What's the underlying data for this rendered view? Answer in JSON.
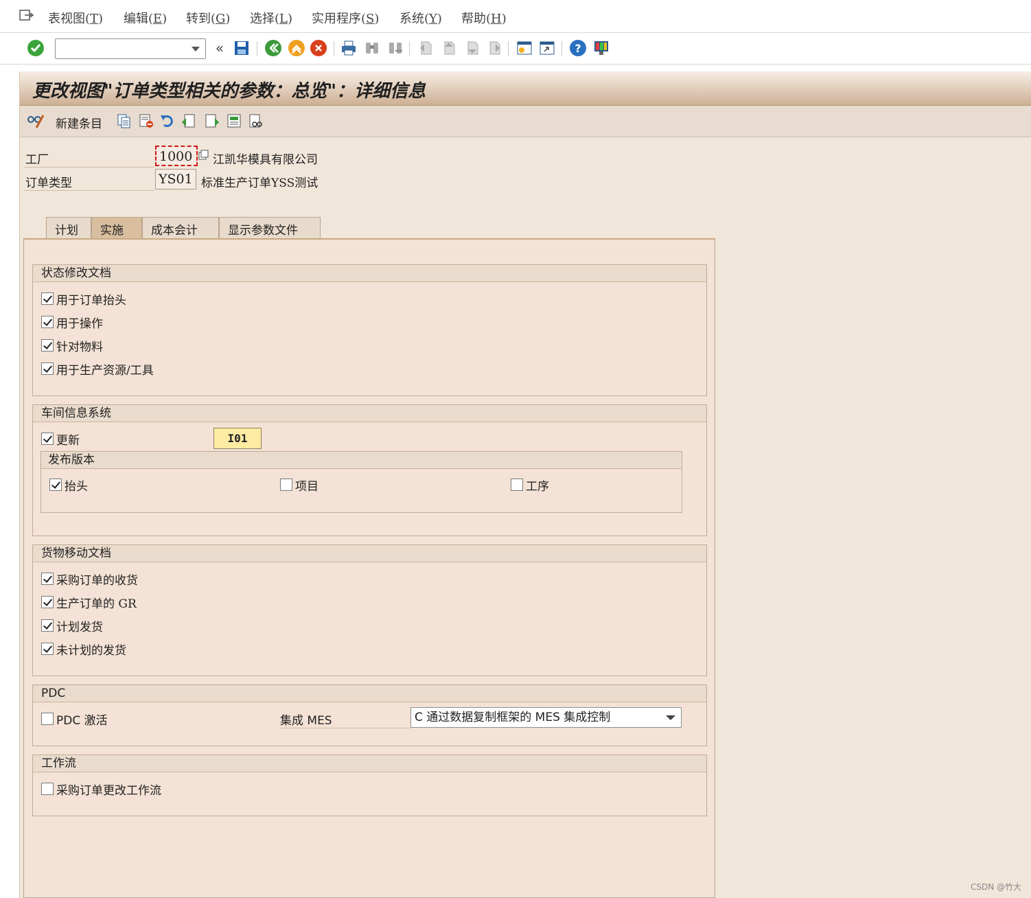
{
  "menu": {
    "items": [
      {
        "label": "表视图(",
        "acc": "T",
        "tail": ")"
      },
      {
        "label": "编辑(",
        "acc": "E",
        "tail": ")"
      },
      {
        "label": "转到(",
        "acc": "G",
        "tail": ")"
      },
      {
        "label": "选择(",
        "acc": "L",
        "tail": ")"
      },
      {
        "label": "实用程序(",
        "acc": "S",
        "tail": ")"
      },
      {
        "label": "系统(",
        "acc": "Y",
        "tail": ")"
      },
      {
        "label": "帮助(",
        "acc": "H",
        "tail": ")"
      }
    ]
  },
  "toolbar": {
    "command_value": "",
    "icons": [
      "enter-check-icon",
      "collapse-icon",
      "save-icon",
      "back-icon",
      "exit-icon",
      "cancel-icon",
      "print-icon",
      "find-icon",
      "find-next-icon",
      "first-page-icon",
      "prev-page-icon",
      "next-page-icon",
      "last-page-icon",
      "new-session-icon",
      "shortcut-icon",
      "help-icon",
      "customize-layout-icon"
    ]
  },
  "title": "更改视图\"订单类型相关的参数：总览\"：详细信息",
  "app_toolbar": {
    "new_entries_label": "新建条目"
  },
  "header_fields": {
    "plant_label": "工厂",
    "plant_value": "1000",
    "plant_desc": "江凯华模具有限公司",
    "order_type_label": "订单类型",
    "order_type_value": "YS01",
    "order_type_desc": "标准生产订单YSS测试"
  },
  "tabs": [
    {
      "label": "计划",
      "active": false
    },
    {
      "label": "实施",
      "active": true
    },
    {
      "label": "成本会计",
      "active": false
    },
    {
      "label": "显示参数文件",
      "active": false
    }
  ],
  "status_docs": {
    "header": "状态修改文档",
    "items": [
      {
        "label": "用于订单抬头",
        "checked": true
      },
      {
        "label": "用于操作",
        "checked": true
      },
      {
        "label": "针对物料",
        "checked": true
      },
      {
        "label": "用于生产资源/工具",
        "checked": true
      }
    ]
  },
  "shopfloor": {
    "header": "车间信息系统",
    "update_label": "更新",
    "update_checked": true,
    "update_button": "I01",
    "release": {
      "header": "发布版本",
      "header_label": "抬头",
      "header_checked": true,
      "item_label": "项目",
      "item_checked": false,
      "operation_label": "工序",
      "operation_checked": false
    }
  },
  "goods_movement": {
    "header": "货物移动文档",
    "items": [
      {
        "label": "采购订单的收货",
        "checked": true
      },
      {
        "label": "生产订单的 GR",
        "checked": true
      },
      {
        "label": "计划发货",
        "checked": true
      },
      {
        "label": "未计划的发货",
        "checked": true
      }
    ]
  },
  "pdc": {
    "header": "PDC",
    "activate_label": "PDC 激活",
    "activate_checked": false,
    "mes_label": "集成 MES",
    "mes_value": "C 通过数据复制框架的 MES 集成控制"
  },
  "workflow": {
    "header": "工作流",
    "po_label": "采购订单更改工作流",
    "po_checked": false
  },
  "watermark": "CSDN @竹大"
}
